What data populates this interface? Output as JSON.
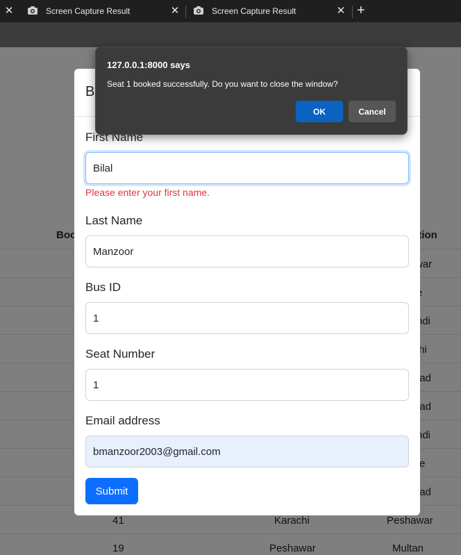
{
  "browser": {
    "tabs": [
      {
        "title": "Screen Capture Result"
      },
      {
        "title": "Screen Capture Result"
      }
    ],
    "new_tab_symbol": "+",
    "close_symbol": "✕"
  },
  "page": {
    "table": {
      "headers": [
        "Boo",
        "ation"
      ],
      "rows": [
        {
          "id": "",
          "source": "",
          "destination": "war"
        },
        {
          "id": "",
          "source": "",
          "destination": "e"
        },
        {
          "id": "",
          "source": "",
          "destination": "ndi"
        },
        {
          "id": "",
          "source": "",
          "destination": "hi"
        },
        {
          "id": "",
          "source": "",
          "destination": "bad"
        },
        {
          "id": "",
          "source": "",
          "destination": "bad"
        },
        {
          "id": "",
          "source": "",
          "destination": "ndi"
        },
        {
          "id": "",
          "source": "",
          "destination": "e"
        },
        {
          "id": "",
          "source": "",
          "destination": "bad"
        },
        {
          "id": "41",
          "source": "Karachi",
          "destination": "Peshawar"
        },
        {
          "id": "19",
          "source": "Peshawar",
          "destination": "Multan"
        }
      ]
    }
  },
  "modal": {
    "title": "B",
    "close_symbol": "✕",
    "fields": {
      "first_name": {
        "label": "First Name",
        "value": "Bilal",
        "error": "Please enter your first name."
      },
      "last_name": {
        "label": "Last Name",
        "value": "Manzoor"
      },
      "bus_id": {
        "label": "Bus ID",
        "value": "1"
      },
      "seat_number": {
        "label": "Seat Number",
        "value": "1"
      },
      "email": {
        "label": "Email address",
        "value": "bmanzoor2003@gmail.com"
      }
    },
    "submit_label": "Submit"
  },
  "dialog": {
    "title": "127.0.0.1:8000 says",
    "message": "Seat 1 booked successfully. Do you want to close the window?",
    "ok_label": "OK",
    "cancel_label": "Cancel"
  },
  "colors": {
    "primary": "#0d6efd",
    "error": "#dc3545",
    "dialog_ok": "#0b62c0",
    "dialog_bg": "#3b3b3b"
  }
}
